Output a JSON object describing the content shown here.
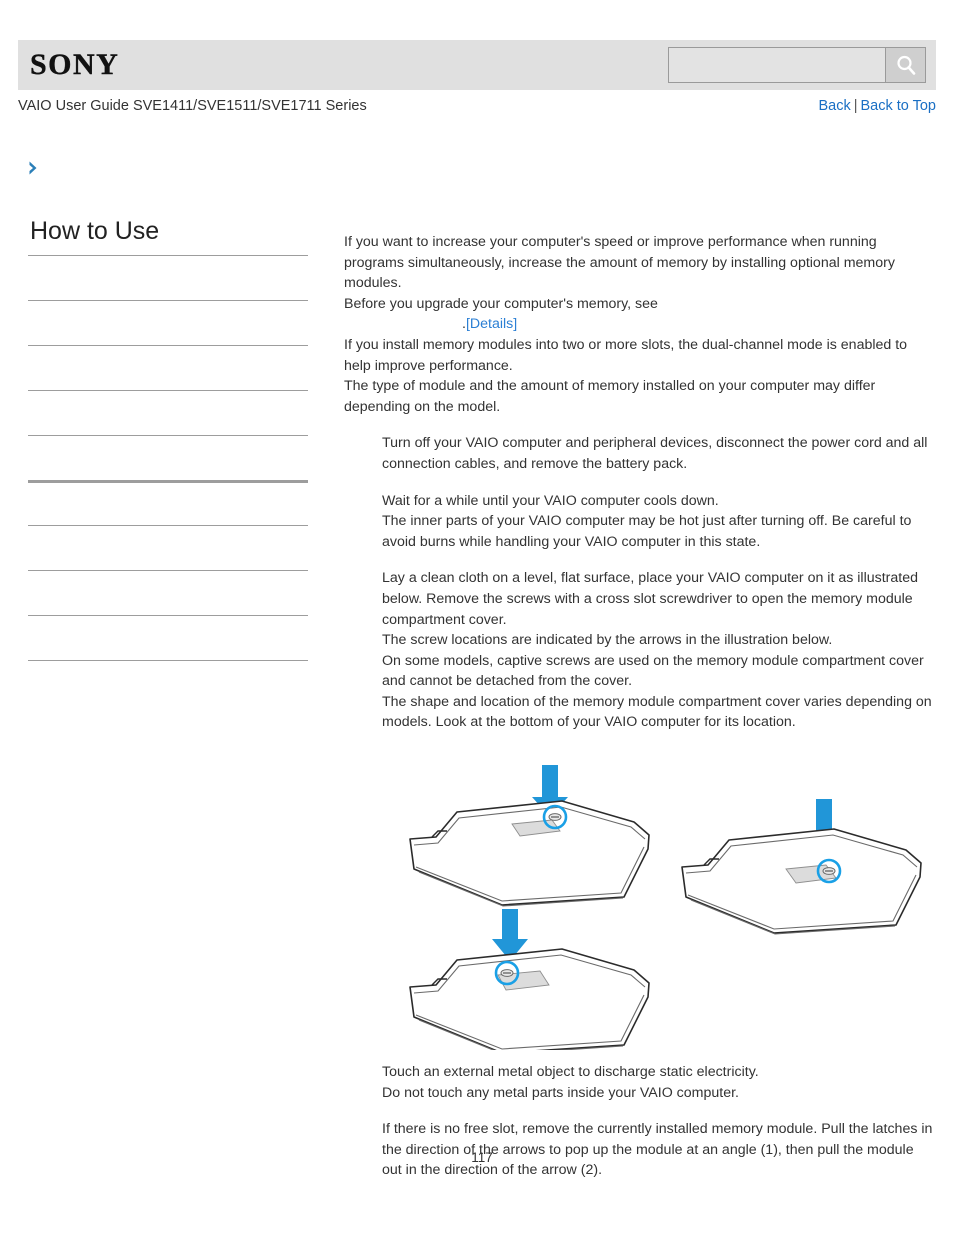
{
  "header": {
    "logo": "SONY",
    "search": {
      "value": "",
      "placeholder": "",
      "icon": "search-icon",
      "button_label": ""
    }
  },
  "subheader": {
    "guide_title": "VAIO User Guide SVE1411/SVE1511/SVE1711 Series",
    "links": {
      "back": "Back",
      "separator": "|",
      "back_to_top": "Back to Top"
    }
  },
  "breadcrumb": {
    "icon": "chevron-right-icon",
    "text": ""
  },
  "sidebar": {
    "title": "How to Use",
    "items": [
      {
        "label": "",
        "thick": false
      },
      {
        "label": "",
        "thick": false
      },
      {
        "label": "",
        "thick": false
      },
      {
        "label": "",
        "thick": false
      },
      {
        "label": "",
        "thick": false
      },
      {
        "label": "",
        "thick": true
      },
      {
        "label": "",
        "thick": false
      },
      {
        "label": "",
        "thick": false
      },
      {
        "label": "",
        "thick": false
      },
      {
        "label": "",
        "thick": false
      }
    ]
  },
  "content": {
    "intro": {
      "line1": "If you want to increase your computer's speed or improve performance when running programs simultaneously, increase the amount of memory by installing optional memory modules.",
      "line2": "Before you upgrade your computer's memory, see",
      "details_dot": ".",
      "details_link": "[Details]",
      "line3": "If you install memory modules into two or more slots, the dual-channel mode is enabled to help improve performance.",
      "line4": "The type of module and the amount of memory installed on your computer may differ depending on the model."
    },
    "steps": [
      {
        "paragraphs": [
          "Turn off your VAIO computer and peripheral devices, disconnect the power cord and all connection cables, and remove the battery pack."
        ]
      },
      {
        "paragraphs": [
          "Wait for a while until your VAIO computer cools down.",
          "The inner parts of your VAIO computer may be hot just after turning off. Be careful to avoid burns while handling your VAIO computer in this state."
        ]
      },
      {
        "paragraphs": [
          "Lay a clean cloth on a level, flat surface, place your VAIO computer on it as illustrated below. Remove the screws with a cross slot screwdriver to open the memory module compartment cover.",
          "The screw locations are indicated by the arrows in the illustration below.",
          "On some models, captive screws are used on the memory module compartment cover and cannot be detached from the cover.",
          "The shape and location of the memory module compartment cover varies depending on models. Look at the bottom of your VAIO computer for its location."
        ]
      },
      {
        "paragraphs": [
          "Touch an external metal object to discharge static electricity.",
          "Do not touch any metal parts inside your VAIO computer."
        ]
      },
      {
        "paragraphs": [
          "If there is no free slot, remove the currently installed memory module. Pull the latches in the direction of the arrows to pop up the module at an angle (1), then pull the module out in the direction of the arrow (2)."
        ]
      }
    ],
    "illustrations": {
      "caption": "",
      "figures": [
        {
          "name": "laptop-bottom-screw-center",
          "arrow": "down-arrow-icon"
        },
        {
          "name": "laptop-bottom-screw-right",
          "arrow": "down-arrow-icon"
        },
        {
          "name": "laptop-bottom-screw-left",
          "arrow": "down-arrow-icon"
        }
      ]
    }
  },
  "footer": {
    "page_number": "117"
  },
  "colors": {
    "link": "#2b7fd4",
    "accent_arrow": "#2196d8",
    "header_bg": "#e0e0e0",
    "text": "#333333"
  }
}
